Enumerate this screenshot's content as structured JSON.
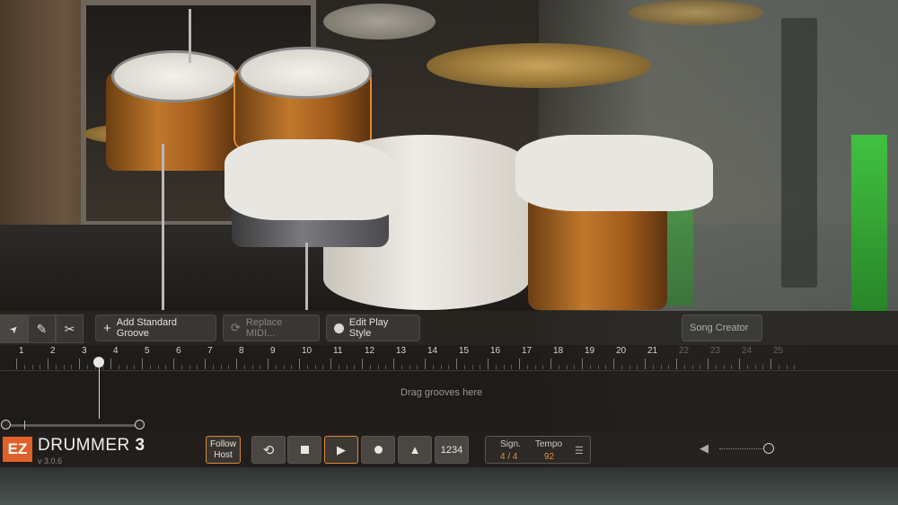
{
  "toolbar": {
    "tools": [
      {
        "name": "select-tool",
        "icon": "arrow-pointer-icon",
        "glyph": "➤"
      },
      {
        "name": "draw-tool",
        "icon": "pencil-plus-icon",
        "glyph": "✎"
      },
      {
        "name": "cut-tool",
        "icon": "scissors-icon",
        "glyph": "✂"
      }
    ],
    "add_standard_groove": "Add Standard Groove",
    "replace_midi": "Replace MIDI...",
    "edit_play_style": "Edit Play Style",
    "song_creator": "Song Creator"
  },
  "timeline": {
    "bars": [
      "1",
      "2",
      "3",
      "4",
      "5",
      "6",
      "7",
      "8",
      "9",
      "10",
      "11",
      "12",
      "13",
      "14",
      "15",
      "16",
      "17",
      "18",
      "19",
      "20",
      "21",
      "22",
      "23",
      "24",
      "25"
    ],
    "drag_hint": "Drag grooves here",
    "playhead_bar": 4
  },
  "transport": {
    "logo_ez": "EZ",
    "logo_name": "DRUMMER",
    "logo_num": "3",
    "version": "v 3.0.6",
    "follow_line1": "Follow",
    "follow_line2": "Host",
    "count_in": "1234",
    "signature_label": "Sign.",
    "signature_value": "4 / 4",
    "tempo_label": "Tempo",
    "tempo_value": "92"
  },
  "colors": {
    "accent": "#e08a30",
    "logo": "#e0602a"
  }
}
